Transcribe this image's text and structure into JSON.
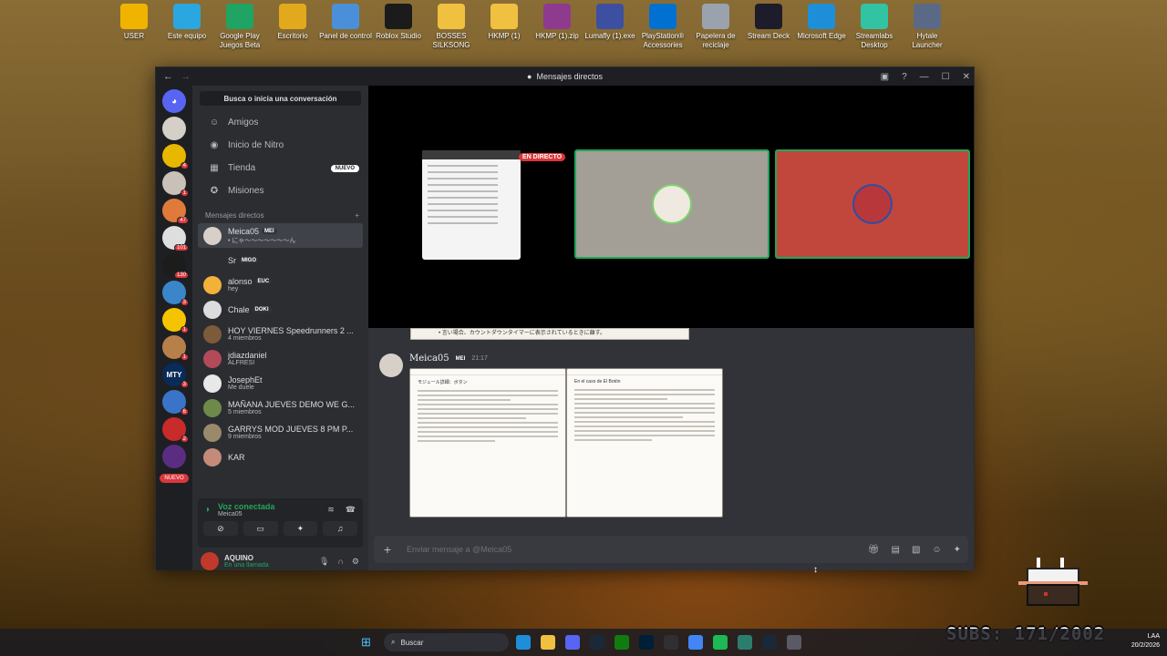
{
  "desktop": {
    "icons": [
      {
        "label": "USER",
        "icon": "user-folder-icon",
        "color": "#f0b400"
      },
      {
        "label": "Este equipo",
        "icon": "monitor-icon",
        "color": "#2aa6e0"
      },
      {
        "label": "Google Play Juegos Beta",
        "icon": "google-play-games-icon",
        "color": "#1fa463"
      },
      {
        "label": "Escritorio",
        "icon": "desktop-folder-icon",
        "color": "#e2a91c"
      },
      {
        "label": "Panel de control",
        "icon": "control-panel-icon",
        "color": "#4a90d9"
      },
      {
        "label": "Roblox Studio",
        "icon": "roblox-studio-icon",
        "color": "#1b1b1b"
      },
      {
        "label": "BOSSES SILKSONG",
        "icon": "folder-icon",
        "color": "#f0c040"
      },
      {
        "label": "HKMP (1)",
        "icon": "folder-icon",
        "color": "#f0c040"
      },
      {
        "label": "HKMP (1).zip",
        "icon": "winrar-icon",
        "color": "#8e3a8e"
      },
      {
        "label": "Lumafly (1).exe",
        "icon": "lumafly-icon",
        "color": "#3c4fa0"
      },
      {
        "label": "PlayStation® Accessories",
        "icon": "playstation-icon",
        "color": "#0070d1"
      },
      {
        "label": "Papelera de reciclaje",
        "icon": "recycle-bin-icon",
        "color": "#9aa3ad"
      },
      {
        "label": "Stream Deck",
        "icon": "stream-deck-icon",
        "color": "#1c1c2a"
      },
      {
        "label": "Microsoft Edge",
        "icon": "edge-icon",
        "color": "#1d8fd8"
      },
      {
        "label": "Streamlabs Desktop",
        "icon": "streamlabs-icon",
        "color": "#31c3a2"
      },
      {
        "label": "Hytale Launcher",
        "icon": "hytale-icon",
        "color": "#5a6a86"
      }
    ]
  },
  "window": {
    "title": "Mensajes directos",
    "back": "←",
    "forward": "→"
  },
  "servers": {
    "items": [
      {
        "badge": "",
        "color": "#5865f2"
      },
      {
        "badge": "",
        "color": "#d4cfc7"
      },
      {
        "badge": "4",
        "color": "#e6b800"
      },
      {
        "badge": "1",
        "color": "#c9c1b8"
      },
      {
        "badge": "47",
        "color": "#e07a3a"
      },
      {
        "badge": "101",
        "color": "#dedede"
      },
      {
        "badge": "130",
        "color": "#1c1c1c"
      },
      {
        "badge": "3",
        "color": "#3a86c8"
      },
      {
        "badge": "1",
        "color": "#f5c400"
      },
      {
        "badge": "1",
        "color": "#b7804b"
      },
      {
        "badge": "3",
        "color": "#0a2a5a"
      },
      {
        "badge": "6",
        "color": "#3a74c8"
      },
      {
        "badge": "2",
        "color": "#c92a2a"
      },
      {
        "badge": "",
        "color": "#5a2d82"
      }
    ],
    "mty_label": "MTY",
    "new_label": "NUEVO"
  },
  "sidebar": {
    "search_label": "Busca o inicia una conversación",
    "nav": [
      {
        "label": "Amigos",
        "icon": "friends-icon"
      },
      {
        "label": "Inicio de Nitro",
        "icon": "nitro-icon"
      },
      {
        "label": "Tienda",
        "icon": "shop-icon",
        "pill": "NUEVO"
      },
      {
        "label": "Misiones",
        "icon": "quests-icon"
      }
    ],
    "dm_header": "Mensajes directos",
    "dm_add": "+",
    "dms": [
      {
        "name": "Meica05",
        "tag": "MEI",
        "sub": "• にゃ〜〜〜〜〜〜〜ん",
        "color": "#d6d0c8",
        "active": true
      },
      {
        "name": "Sr",
        "tag": "MIGO",
        "sub": "",
        "color": "#2b2d31"
      },
      {
        "name": "alonso",
        "tag": "EUC",
        "sub": "hey",
        "color": "#f2b23a"
      },
      {
        "name": "Chale",
        "tag": "DOKI",
        "sub": "",
        "color": "#dcdcdc"
      },
      {
        "name": "HOY VIERNES Speedrunners 2 ...",
        "tag": "",
        "sub": "4 miembros",
        "color": "#7c5a3a"
      },
      {
        "name": "jdiazdaniel",
        "tag": "",
        "sub": "ALFRESI",
        "color": "#b24a5a"
      },
      {
        "name": "JosephEt",
        "tag": "",
        "sub": "Me duele",
        "color": "#e8e8e8"
      },
      {
        "name": "MAÑANA JUEVES DEMO WE G...",
        "tag": "",
        "sub": "5 miembros",
        "color": "#6e8a4a"
      },
      {
        "name": "GARRYS MOD JUEVES 8 PM P...",
        "tag": "",
        "sub": "9 miembros",
        "color": "#9a8a6a"
      },
      {
        "name": "KAR",
        "tag": "",
        "sub": "",
        "color": "#c48a7a"
      }
    ],
    "voice": {
      "title": "Voz conectada",
      "sub": "Meica05"
    },
    "user": {
      "name": "AQUINO",
      "status": "En una llamada"
    }
  },
  "call": {
    "live_label": "EN DIRECTO"
  },
  "chat": {
    "strip_text": "• 言い場合、カウントダウンタイマーに表示されているときに離す。",
    "message": {
      "author": "Meica05",
      "tag": "MEI",
      "time": "21:17"
    },
    "attachments": [
      {
        "title": "モジュール詳細：ボタン"
      },
      {
        "title": "En el caso de El Botón"
      }
    ],
    "composer_placeholder": "Enviar mensaje a @Meica05"
  },
  "taskbar": {
    "search_label": "Buscar",
    "apps": [
      {
        "icon": "edge-icon",
        "color": "#1d8fd8"
      },
      {
        "icon": "file-explorer-icon",
        "color": "#f0c040"
      },
      {
        "icon": "discord-icon",
        "color": "#5865f2"
      },
      {
        "icon": "steam-icon",
        "color": "#1b2838"
      },
      {
        "icon": "xbox-icon",
        "color": "#107c10"
      },
      {
        "icon": "photoshop-icon",
        "color": "#001e36"
      },
      {
        "icon": "obs-icon",
        "color": "#302e31"
      },
      {
        "icon": "chrome-icon",
        "color": "#4285f4"
      },
      {
        "icon": "spotify-icon",
        "color": "#1db954"
      },
      {
        "icon": "terminal-icon",
        "color": "#2d7d6e"
      },
      {
        "icon": "steam-icon",
        "color": "#1b2838"
      },
      {
        "icon": "settings-icon",
        "color": "#5a5a66"
      }
    ],
    "clock_label": "LAA",
    "date": "20/2/2026"
  },
  "overlay": {
    "subs": "SUBS: 171/2002"
  }
}
